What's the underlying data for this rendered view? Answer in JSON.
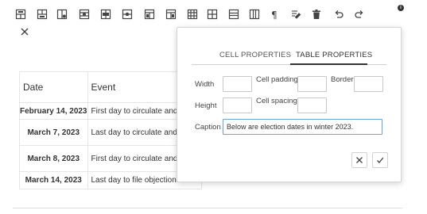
{
  "toolbar": {
    "icons": [
      "table-insert-row-above-icon",
      "table-insert-row-below-icon",
      "table-insert-column-left-icon",
      "table-insert-column-right-icon",
      "table-delete-row-icon",
      "table-delete-column-icon",
      "table-merge-cells-icon",
      "table-split-cells-icon",
      "table-vertical-align-icon",
      "table-horizontal-align-icon",
      "paragraph-icon",
      "edit-icon",
      "delete-icon",
      "undo-icon",
      "redo-icon"
    ]
  },
  "table": {
    "headers": [
      "Date",
      "Event"
    ],
    "rows": [
      {
        "date": "February 14, 2023",
        "event": "First day to circulate and file no"
      },
      {
        "date": "March 7, 2023",
        "event": "Last day to circulate and file no"
      },
      {
        "date": "March 8, 2023",
        "event": "First day to circulate and file no"
      },
      {
        "date": "March 14, 2023",
        "event": "Last day to file objections to no"
      }
    ]
  },
  "popup": {
    "tabs": [
      "CELL PROPERTIES",
      "TABLE PROPERTIES"
    ],
    "active_tab": "TABLE PROPERTIES",
    "fields": {
      "width_label": "Width",
      "width_value": "",
      "cell_padding_label": "Cell padding",
      "cell_padding_value": "",
      "border_label": "Border",
      "border_value": "",
      "height_label": "Height",
      "height_value": "",
      "cell_spacing_label": "Cell spacing",
      "cell_spacing_value": "",
      "caption_label": "Caption",
      "caption_value": "Below are election dates in winter 2023."
    }
  },
  "colors": {
    "accent_focus": "#6aa3d8",
    "text": "#333333",
    "border": "#c8c8c8"
  }
}
